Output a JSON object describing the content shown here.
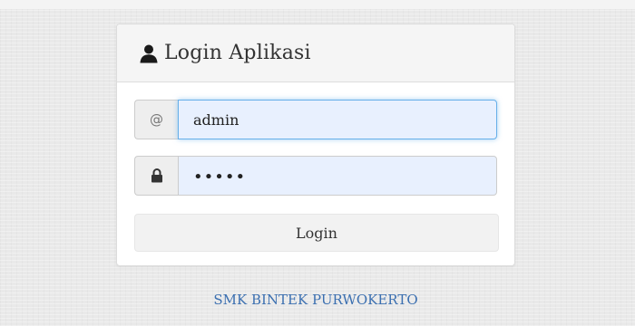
{
  "login_panel": {
    "title": "Login Aplikasi",
    "title_icon": "user-icon"
  },
  "username": {
    "addon_symbol": "@",
    "value": "admin"
  },
  "password": {
    "addon_icon": "lock-icon",
    "value": "•••••"
  },
  "login_button": {
    "label": "Login"
  },
  "footer": {
    "link_text": "SMK BINTEK PURWOKERTO"
  },
  "colors": {
    "page_background": "#e9e9e9",
    "input_autofill": "#e8f0fe",
    "focus_border": "#66afe9",
    "link": "#3b6fb0"
  }
}
